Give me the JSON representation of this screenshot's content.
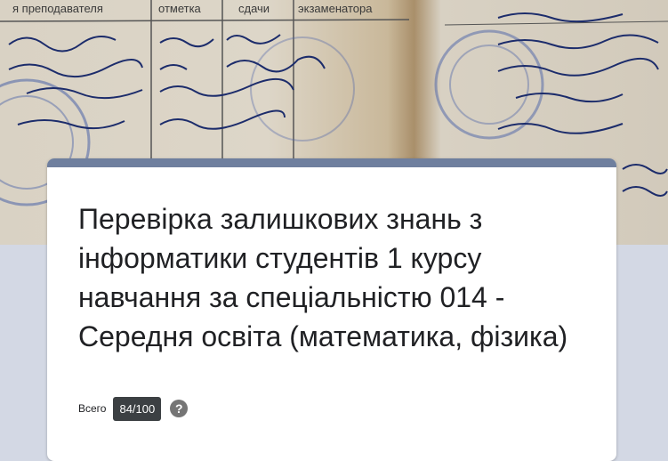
{
  "header_image": {
    "column_labels": [
      "я преподавателя",
      "отметка",
      "сдачи",
      "экзаменатора"
    ]
  },
  "form": {
    "title": "Перевірка залишкових знань з інформатики студентів 1 курсу навчання за спеціальністю 014 - Середня освіта (математика, фізика)",
    "score_label": "Всего",
    "score_value": "84/100",
    "help_icon": "question-mark-icon"
  },
  "colors": {
    "background": "#d3d8e4",
    "card_accent": "#6f7f9e",
    "badge": "#3c4043"
  }
}
